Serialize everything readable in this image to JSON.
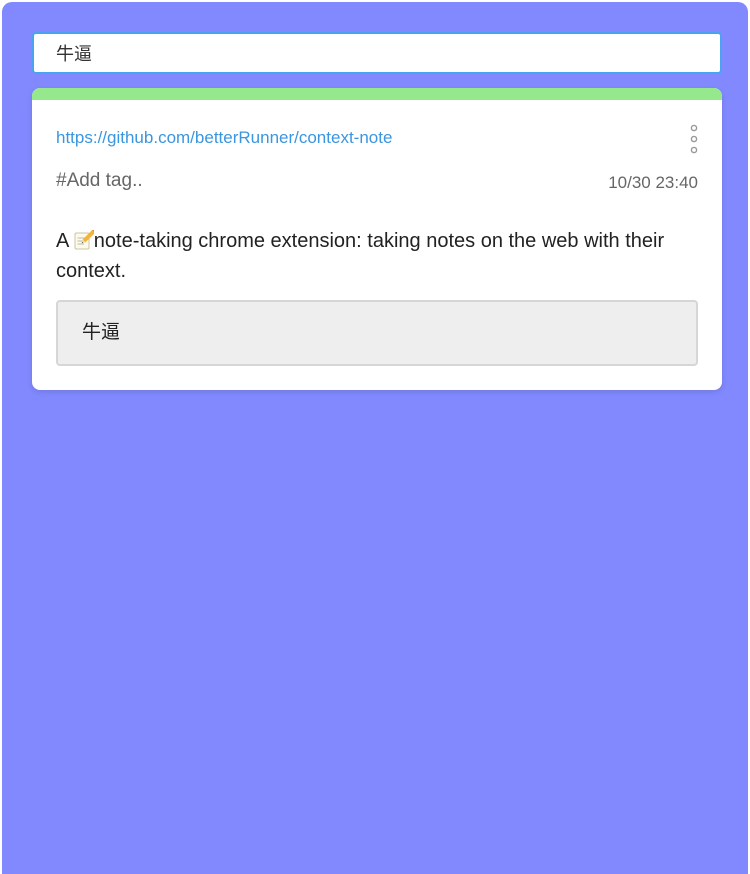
{
  "search": {
    "value": "牛逼"
  },
  "note": {
    "url": "https://github.com/betterRunner/context-note",
    "tag_placeholder": "#Add tag..",
    "timestamp": "10/30 23:40",
    "quote_prefix": "A ",
    "quote_icon": "pencil-memo-icon",
    "quote_text": "note-taking chrome extension: taking notes on the web with their context.",
    "comment": "牛逼",
    "more_icon": "vertical-ellipsis-icon"
  },
  "colors": {
    "background": "#8289ff",
    "accent_bar": "#95e88b",
    "link": "#3a96e0",
    "search_border": "#4aa3f0",
    "comment_bg": "#eeeeee"
  }
}
